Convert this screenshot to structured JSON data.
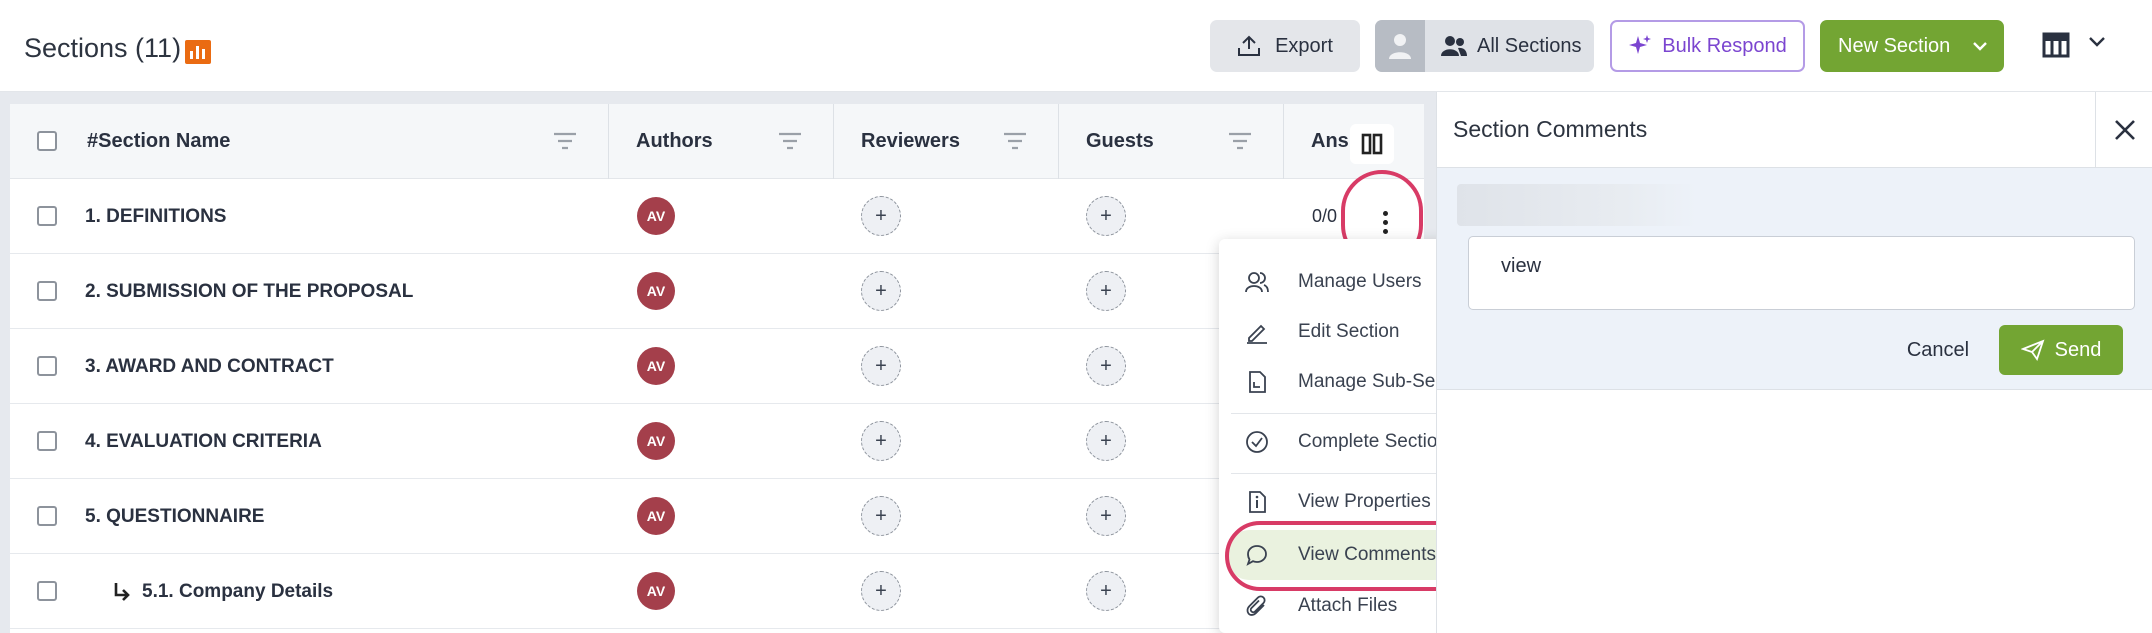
{
  "header": {
    "title": "Sections (11)",
    "export_label": "Export",
    "all_sections_label": "All Sections",
    "bulk_respond_label": "Bulk Respond",
    "new_section_label": "New Section"
  },
  "table": {
    "columns": {
      "number_prefix": "#",
      "section_name": "Section Name",
      "authors": "Authors",
      "reviewers": "Reviewers",
      "guests": "Guests",
      "answers": "Ans"
    },
    "rows": [
      {
        "name": "1. DEFINITIONS",
        "author_initials": "AV",
        "answers": "0/0"
      },
      {
        "name": "2. SUBMISSION OF THE PROPOSAL",
        "author_initials": "AV"
      },
      {
        "name": "3. AWARD AND CONTRACT",
        "author_initials": "AV"
      },
      {
        "name": "4. EVALUATION CRITERIA",
        "author_initials": "AV"
      },
      {
        "name": "5. QUESTIONNAIRE",
        "author_initials": "AV"
      },
      {
        "name": "5.1. Company Details",
        "author_initials": "AV",
        "subsection": true
      }
    ]
  },
  "context_menu": {
    "items": [
      {
        "label": "Manage Users",
        "icon": "users-icon"
      },
      {
        "label": "Edit Section",
        "icon": "pencil-icon"
      },
      {
        "label": "Manage Sub-Sections",
        "icon": "document-icon"
      },
      {
        "label": "Complete Section",
        "icon": "check-circle-icon"
      },
      {
        "label": "View Properties",
        "icon": "info-document-icon"
      },
      {
        "label": "View Comments",
        "icon": "comment-icon",
        "highlighted": true
      },
      {
        "label": "Attach Files",
        "icon": "paperclip-icon"
      }
    ]
  },
  "panel": {
    "title": "Section Comments",
    "comment_text": "view",
    "cancel_label": "Cancel",
    "send_label": "Send"
  },
  "colors": {
    "primary_green": "#73a533",
    "author_avatar": "#a43f4b",
    "highlight_ring": "#d83b66",
    "bulk_purple": "#7b45d0"
  }
}
